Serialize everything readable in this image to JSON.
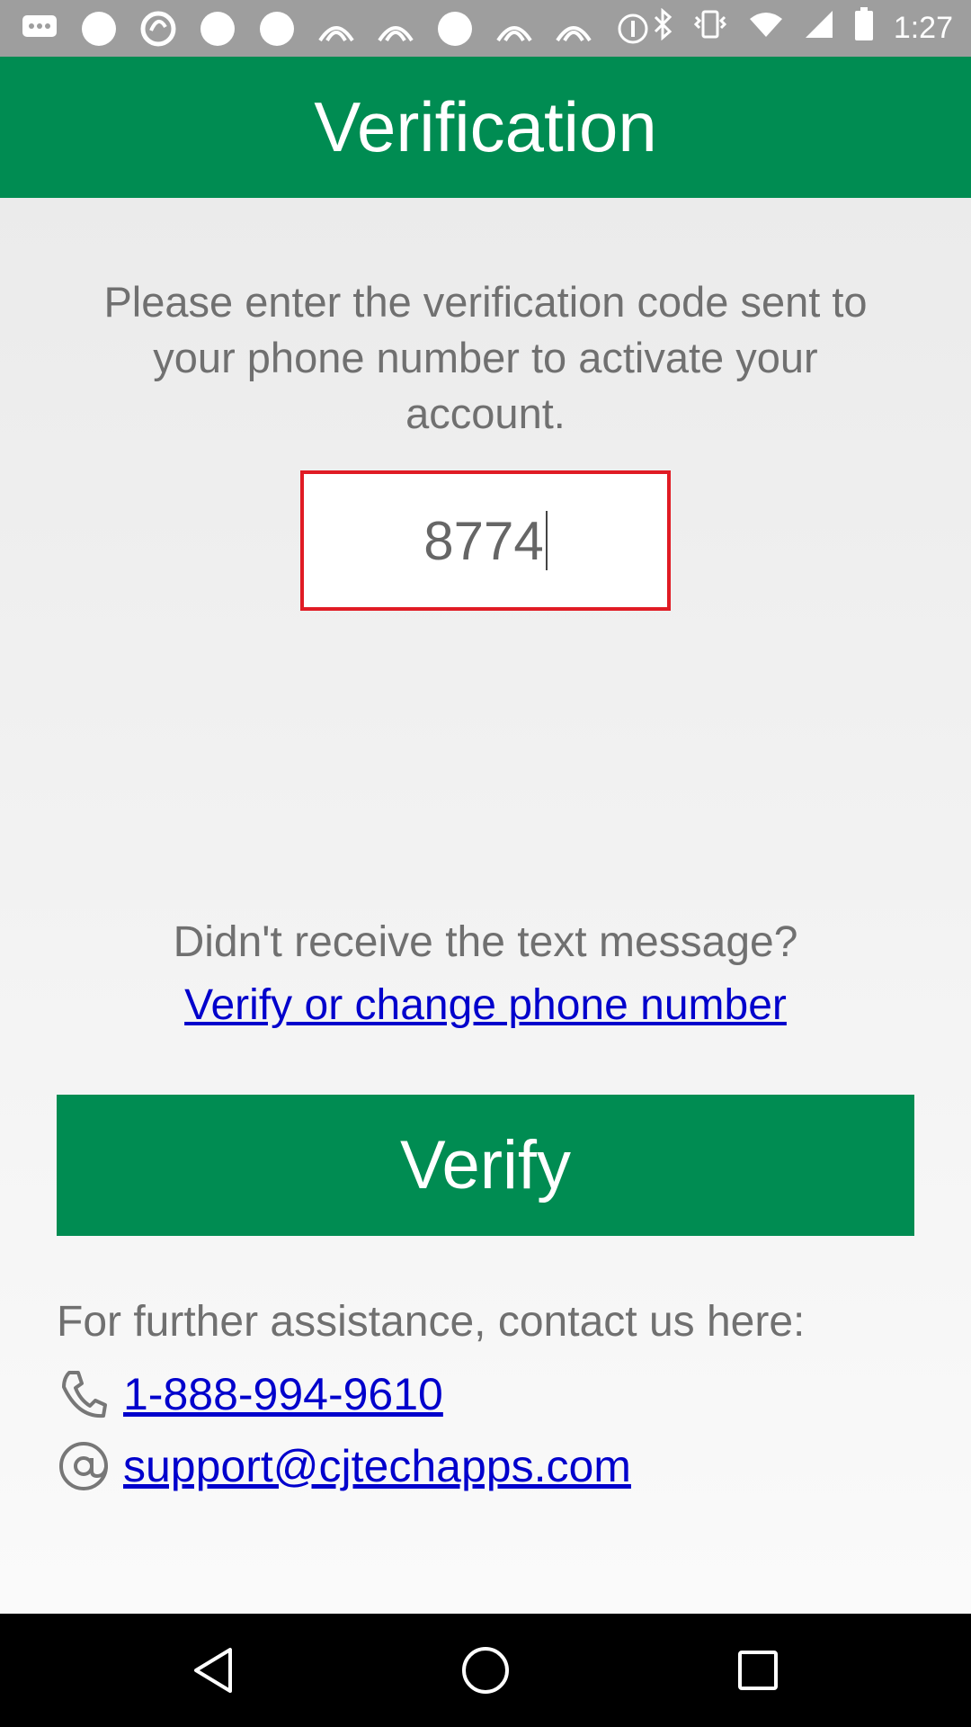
{
  "status_bar": {
    "time": "1:27",
    "left_icons": [
      "chat-icon",
      "circle-icon",
      "sync-icon",
      "circle-icon",
      "circle-icon",
      "signal-icon",
      "signal-icon",
      "circle-icon",
      "signal-icon",
      "signal-icon",
      "info-icon"
    ],
    "right_icons": [
      "bluetooth-icon",
      "vibrate-icon",
      "wifi-icon",
      "cell-signal-icon",
      "battery-icon"
    ]
  },
  "appbar": {
    "title": "Verification"
  },
  "main": {
    "instructions": "Please enter the verification code sent to your phone number to activate your account.",
    "code_value": "8774",
    "no_receive_text": "Didn't receive the text message?",
    "change_link": "Verify or change phone number",
    "verify_button": "Verify",
    "assist_text": "For further assistance, contact us here:",
    "phone": "1-888-994-9610",
    "email": "support@cjtechapps.com"
  },
  "navbar": {
    "buttons": [
      "back-icon",
      "home-icon",
      "recents-icon"
    ]
  },
  "colors": {
    "brand_green": "#008c52",
    "link_blue": "#0000cc",
    "error_red": "#e01b24"
  }
}
